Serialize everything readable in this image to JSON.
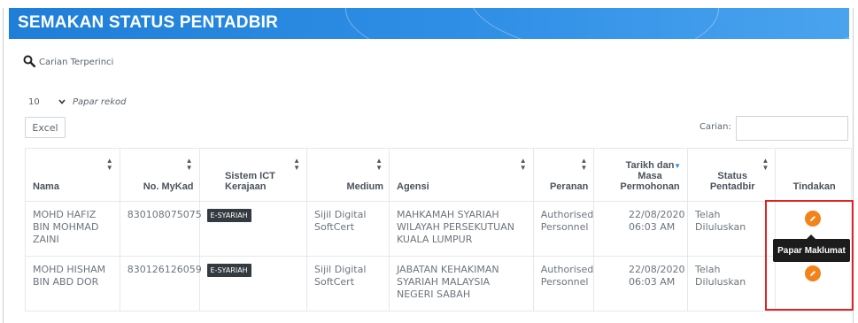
{
  "header": {
    "title": "SEMAKAN STATUS PENTADBIR",
    "bg_color": "#2b8be6"
  },
  "advanced_search": {
    "label": "Carian Terperinci",
    "icon": "search-icon"
  },
  "page_length": {
    "value": "10",
    "label": "Papar rekod"
  },
  "excel_button": {
    "label": "Excel"
  },
  "search": {
    "label": "Carian:",
    "value": ""
  },
  "table": {
    "columns": [
      {
        "label": "Nama",
        "sortable": true
      },
      {
        "label": "No. MyKad",
        "sortable": true
      },
      {
        "label": "Sistem ICT Kerajaan",
        "sortable": true
      },
      {
        "label": "Medium",
        "sortable": true
      },
      {
        "label": "Agensi",
        "sortable": true
      },
      {
        "label": "Peranan",
        "sortable": true
      },
      {
        "label": "Tarikh dan Masa Permohonan",
        "sortable": true,
        "sort_active": "desc"
      },
      {
        "label": "Status Pentadbir",
        "sortable": true
      },
      {
        "label": "Tindakan",
        "sortable": false
      }
    ],
    "rows": [
      {
        "nama": "MOHD HAFIZ BIN MOHMAD ZAINI",
        "mykad": "830108075075",
        "sistem": "E-SYARIAH",
        "medium": "Sijil Digital SoftCert",
        "agensi": "MAHKAMAH SYARIAH WILAYAH PERSEKUTUAN KUALA LUMPUR",
        "peranan": "Authorised Personnel",
        "tarikh": "22/08/2020 06:03 AM",
        "status": "Telah Diluluskan"
      },
      {
        "nama": "MOHD HISHAM BIN ABD DOR",
        "mykad": "830126126059",
        "sistem": "E-SYARIAH",
        "medium": "Sijil Digital SoftCert",
        "agensi": "JABATAN KEHAKIMAN SYARIAH MALAYSIA NEGERI SABAH",
        "peranan": "Authorised Personnel",
        "tarikh": "22/08/2020 06:03 AM",
        "status": "Telah Diluluskan"
      }
    ]
  },
  "tooltip": {
    "text": "Papar Maklumat"
  },
  "colors": {
    "action": "#f2821a",
    "badge": "#333a40",
    "highlight": "#e02424"
  }
}
